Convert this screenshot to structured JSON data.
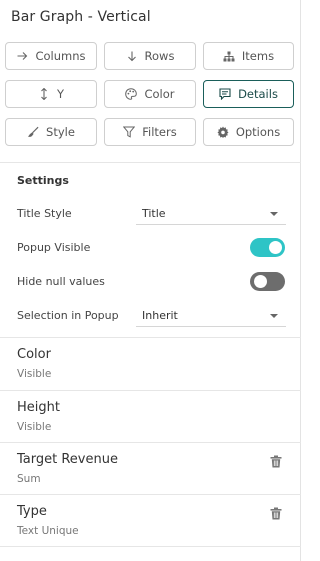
{
  "panel": {
    "title": "Bar Graph - Vertical"
  },
  "buttons": {
    "columns": {
      "label": "Columns",
      "icon": "arrow-right-icon"
    },
    "rows": {
      "label": "Rows",
      "icon": "arrow-down-icon"
    },
    "items": {
      "label": "Items",
      "icon": "hierarchy-icon"
    },
    "y": {
      "label": "Y",
      "icon": "vertical-arrows-icon"
    },
    "color": {
      "label": "Color",
      "icon": "palette-icon"
    },
    "details": {
      "label": "Details",
      "icon": "comment-icon"
    },
    "style": {
      "label": "Style",
      "icon": "brush-icon"
    },
    "filters": {
      "label": "Filters",
      "icon": "funnel-icon"
    },
    "options": {
      "label": "Options",
      "icon": "gear-icon"
    }
  },
  "settings": {
    "heading": "Settings",
    "title_style": {
      "label": "Title Style",
      "value": "Title"
    },
    "popup_visible": {
      "label": "Popup Visible",
      "on": true
    },
    "hide_null": {
      "label": "Hide null values",
      "on": false
    },
    "selection_popup": {
      "label": "Selection in Popup",
      "value": "Inherit"
    }
  },
  "items": [
    {
      "name": "Color",
      "sub": "Visible",
      "deletable": false
    },
    {
      "name": "Height",
      "sub": "Visible",
      "deletable": false
    },
    {
      "name": "Target Revenue",
      "sub": "Sum",
      "deletable": true
    },
    {
      "name": "Type",
      "sub": "Text Unique",
      "deletable": true
    }
  ],
  "colors": {
    "accent_toggle_on": "#2ec4c6",
    "toggle_off": "#6d6d6d",
    "active_border": "#1a5e5a"
  }
}
